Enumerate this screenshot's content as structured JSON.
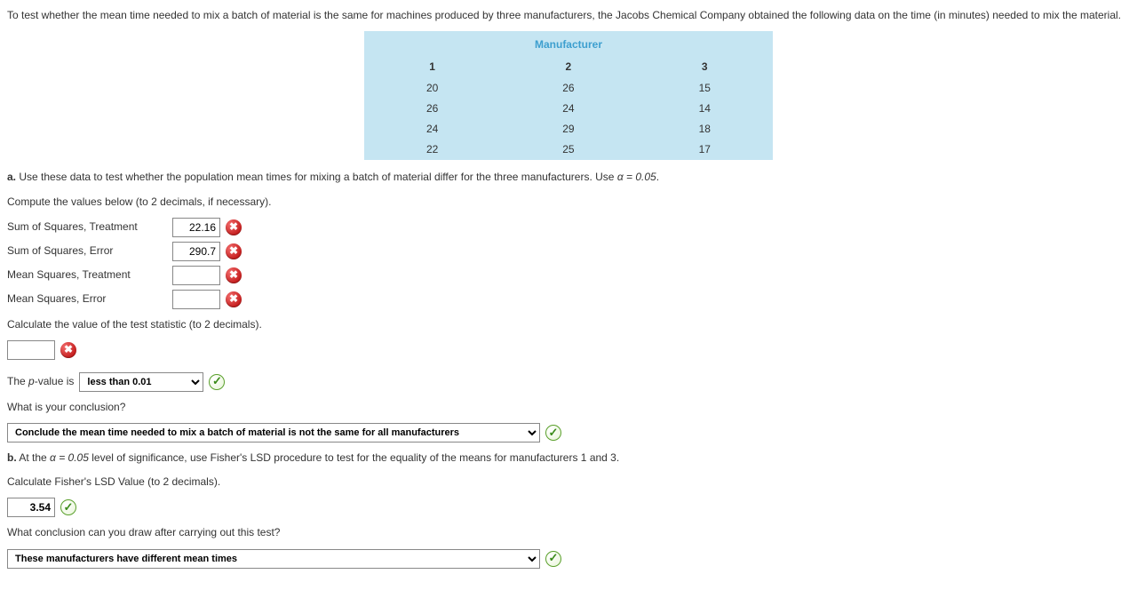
{
  "intro": "To test whether the mean time needed to mix a batch of material is the same for machines produced by three manufacturers, the Jacobs Chemical Company obtained the following data on the time (in minutes) needed to mix the material.",
  "table": {
    "header": "Manufacturer",
    "cols": [
      "1",
      "2",
      "3"
    ],
    "rows": [
      [
        "20",
        "26",
        "15"
      ],
      [
        "26",
        "24",
        "14"
      ],
      [
        "24",
        "29",
        "18"
      ],
      [
        "22",
        "25",
        "17"
      ]
    ]
  },
  "partA": {
    "label": "a.",
    "text": "Use these data to test whether the population mean times for mixing a batch of material differ for the three manufacturers. Use ",
    "alpha": "α = 0.05",
    "period": ".",
    "compute": "Compute the values below (to 2 decimals, if necessary).",
    "fields": {
      "sstLabel": "Sum of Squares, Treatment",
      "sstValue": "22.16",
      "sseLabel": "Sum of Squares, Error",
      "sseValue": "290.7",
      "mstLabel": "Mean Squares, Treatment",
      "mstValue": "",
      "mseLabel": "Mean Squares, Error",
      "mseValue": ""
    },
    "testStat": "Calculate the value of the test statistic (to 2 decimals).",
    "testStatValue": "",
    "pValueLabel": "The p-value is",
    "pValueSelected": "less than 0.01",
    "conclusionQ": "What is your conclusion?",
    "conclusionSelected": "Conclude the mean time needed to mix a batch of material is not the same for all manufacturers"
  },
  "partB": {
    "label": "b.",
    "text": "At the ",
    "alpha": "α = 0.05",
    "text2": " level of significance, use Fisher's LSD procedure to test for the equality of the means for manufacturers 1 and 3.",
    "lsdCalc": "Calculate Fisher's LSD Value (to 2 decimals).",
    "lsdValue": "3.54",
    "conclusionQ": "What conclusion can you draw after carrying out this test?",
    "conclusionSelected": "These manufacturers have different mean times"
  },
  "iconX": "✖",
  "iconCheck": "✓"
}
